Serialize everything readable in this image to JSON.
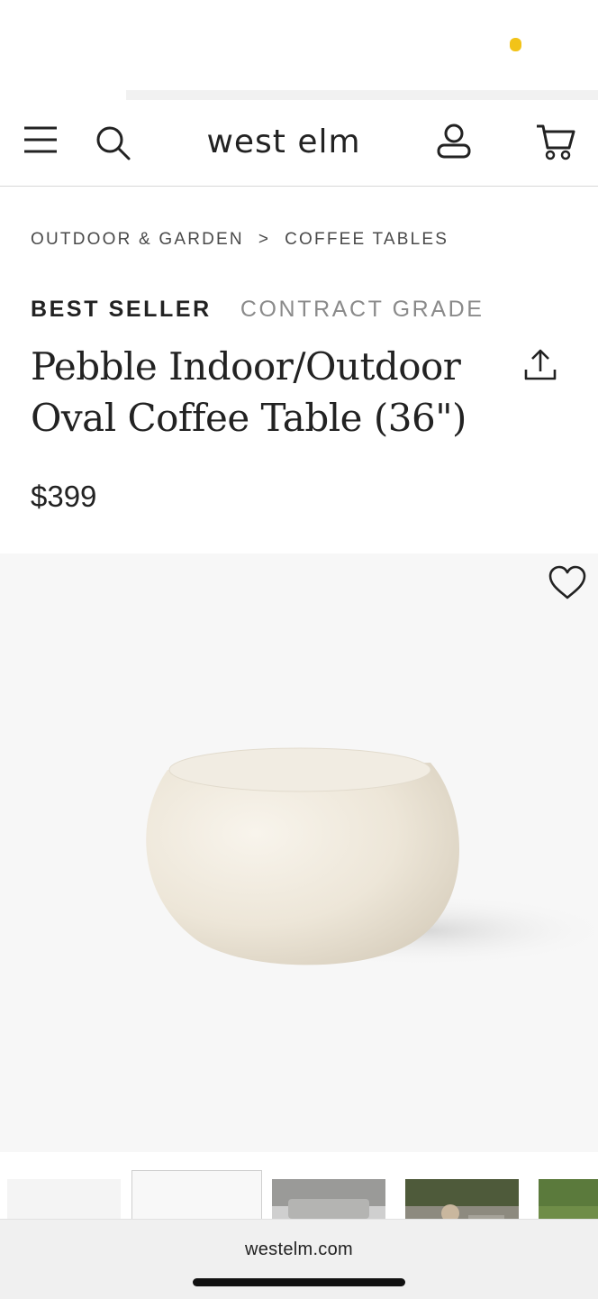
{
  "header": {
    "brand": "west elm",
    "menu_icon": "hamburger-menu-icon",
    "search_icon": "search-icon",
    "account_icon": "account-icon",
    "cart_icon": "cart-icon"
  },
  "breadcrumb": {
    "items": [
      "OUTDOOR & GARDEN",
      "COFFEE TABLES"
    ],
    "separator": ">"
  },
  "product": {
    "badges": [
      "BEST SELLER",
      "CONTRACT GRADE"
    ],
    "title": "Pebble Indoor/Outdoor Oval Coffee Table (36\")",
    "price": "$399",
    "share_icon": "share-icon",
    "favorite_icon": "heart-icon"
  },
  "colors": {
    "status_dot": "#f2c318",
    "hero_background": "#f7f7f7",
    "table_finish": "#efe9dd"
  },
  "browser": {
    "url": "westelm.com"
  }
}
